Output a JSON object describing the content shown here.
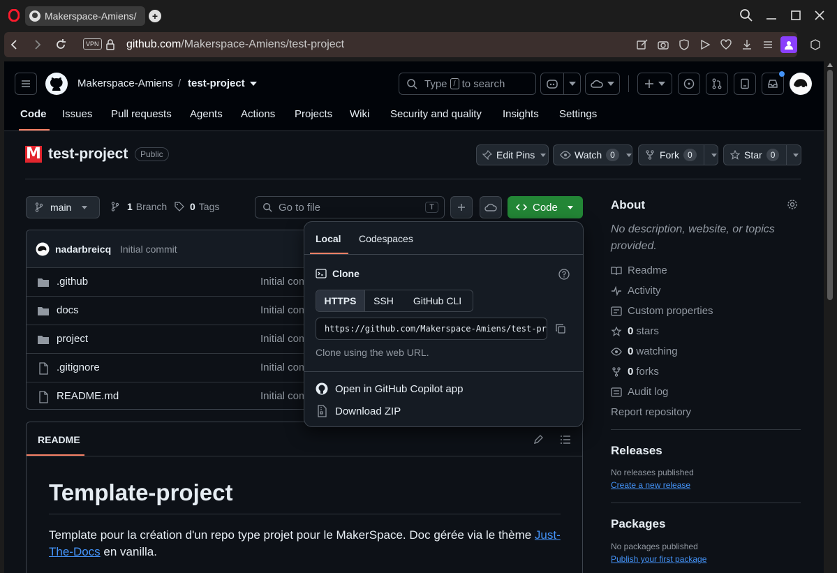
{
  "browser": {
    "tab_title": "Makerspace-Amiens/",
    "vpn_label": "VPN",
    "url_host": "github.com",
    "url_path": "/Makerspace-Amiens/test-project"
  },
  "header": {
    "owner": "Makerspace-Amiens",
    "separator": "/",
    "repo": "test-project",
    "search_placeholder_pre": "Type",
    "search_key": "/",
    "search_placeholder_post": "to search"
  },
  "tabs": [
    "Code",
    "Issues",
    "Pull requests",
    "Agents",
    "Actions",
    "Projects",
    "Wiki",
    "Security and quality",
    "Insights",
    "Settings"
  ],
  "repo": {
    "name": "test-project",
    "visibility": "Public",
    "edit_pins": "Edit Pins",
    "watch": "Watch",
    "watch_count": "0",
    "fork": "Fork",
    "fork_count": "0",
    "star": "Star",
    "star_count": "0"
  },
  "toolbar": {
    "branch": "main",
    "branch_count": "1",
    "branch_label": "Branch",
    "tag_count": "0",
    "tag_label": "Tags",
    "goto_placeholder": "Go to file",
    "goto_key": "T",
    "code_label": "Code"
  },
  "commit": {
    "author": "nadarbreicq",
    "message": "Initial commit"
  },
  "files": [
    {
      "name": ".github",
      "type": "folder",
      "msg": "Initial com"
    },
    {
      "name": "docs",
      "type": "folder",
      "msg": "Initial com"
    },
    {
      "name": "project",
      "type": "folder",
      "msg": "Initial com"
    },
    {
      "name": ".gitignore",
      "type": "file",
      "msg": "Initial com"
    },
    {
      "name": "README.md",
      "type": "file",
      "msg": "Initial com"
    }
  ],
  "readme": {
    "tab": "README",
    "title": "Template-project",
    "text_pre": "Template pour la création d'un repo type projet pour le MakerSpace. Doc gérée via le thème ",
    "link_text_1": "Just-",
    "link_text_2": "The-Docs",
    "text_post": " en vanilla."
  },
  "popover": {
    "tab_local": "Local",
    "tab_codespaces": "Codespaces",
    "clone_title": "Clone",
    "protocols": [
      "HTTPS",
      "SSH",
      "GitHub CLI"
    ],
    "clone_url": "https://github.com/Makerspace-Amiens/test-project.git",
    "clone_hint": "Clone using the web URL.",
    "open_copilot": "Open in GitHub Copilot app",
    "download_zip": "Download ZIP"
  },
  "about": {
    "title": "About",
    "description": "No description, website, or topics provided.",
    "readme": "Readme",
    "activity": "Activity",
    "custom_properties": "Custom properties",
    "stars_count": "0",
    "stars_label": "stars",
    "watching_count": "0",
    "watching_label": "watching",
    "forks_count": "0",
    "forks_label": "forks",
    "audit_log": "Audit log",
    "report": "Report repository"
  },
  "releases": {
    "title": "Releases",
    "none": "No releases published",
    "create": "Create a new release"
  },
  "packages": {
    "title": "Packages",
    "none": "No packages published",
    "publish": "Publish your first package"
  },
  "colors": {
    "accent_green": "#238636",
    "link_blue": "#4493f8",
    "tab_underline": "#f78166",
    "notification_dot": "#4493f8",
    "logo_red": "#e3262e"
  }
}
